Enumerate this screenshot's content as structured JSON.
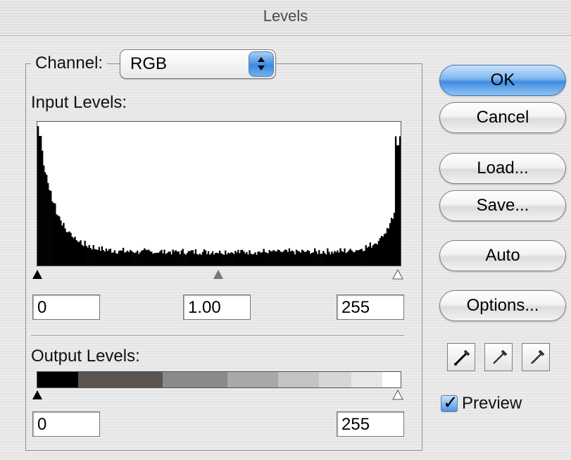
{
  "window": {
    "title": "Levels"
  },
  "channel": {
    "label": "Channel:",
    "value": "RGB"
  },
  "input_levels": {
    "label": "Input Levels:",
    "black": "0",
    "gamma": "1.00",
    "white": "255"
  },
  "output_levels": {
    "label": "Output Levels:",
    "black": "0",
    "white": "255"
  },
  "buttons": {
    "ok": "OK",
    "cancel": "Cancel",
    "load": "Load...",
    "save": "Save...",
    "auto": "Auto",
    "options": "Options..."
  },
  "eyedroppers": [
    "black-point-eyedropper-icon",
    "gray-point-eyedropper-icon",
    "white-point-eyedropper-icon"
  ],
  "preview": {
    "label": "Preview",
    "checked": true
  },
  "colors": {
    "accent": "#3f8be0",
    "histogram": "#000000"
  }
}
